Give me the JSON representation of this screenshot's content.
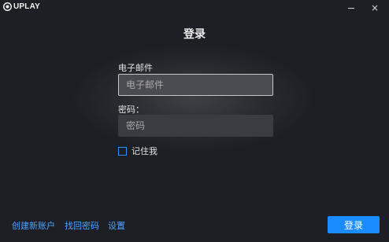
{
  "titlebar": {
    "brand": "UPLAY",
    "minimize_icon": "minimize-icon",
    "close_glyph": "×"
  },
  "login": {
    "heading": "登录",
    "email_label": "电子邮件",
    "email_placeholder": "电子邮件",
    "password_label": "密码：",
    "password_placeholder": "密码",
    "remember_label": "记住我",
    "remember_checked": false,
    "submit_label": "登录"
  },
  "footer": {
    "create_account": "创建新账户",
    "recover_password": "找回密码",
    "settings": "设置"
  },
  "colors": {
    "background": "#1d1f24",
    "accent": "#1a8cff",
    "link": "#4ea3ff"
  }
}
